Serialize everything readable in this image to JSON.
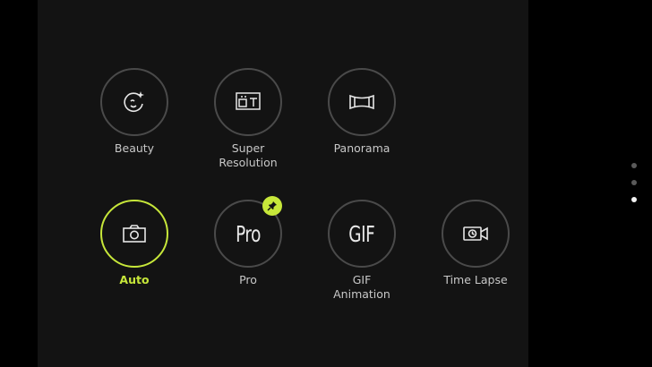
{
  "modes": [
    {
      "label": "Beauty",
      "icon": "beauty-icon",
      "active": false
    },
    {
      "label": "Super\nResolution",
      "icon": "super-resolution-icon",
      "active": false
    },
    {
      "label": "Panorama",
      "icon": "panorama-icon",
      "active": false
    },
    {
      "label": "Auto",
      "icon": "camera-icon",
      "active": true
    },
    {
      "label": "Pro",
      "icon_text": "Pro",
      "pinned": true,
      "active": false
    },
    {
      "label": "GIF\nAnimation",
      "icon_text": "GIF",
      "active": false
    },
    {
      "label": "Time Lapse",
      "icon": "time-lapse-icon",
      "active": false
    }
  ],
  "pages": {
    "count": 3,
    "current": 3
  },
  "colors": {
    "accent": "#c7e73a",
    "ring": "#4a4a4a",
    "panel": "#131313"
  }
}
